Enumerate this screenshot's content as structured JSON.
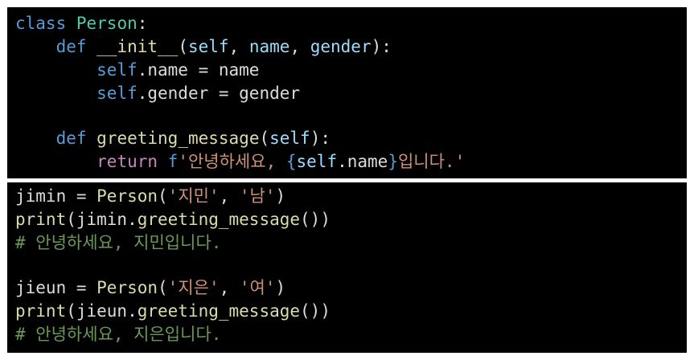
{
  "colors": {
    "background": "#000000",
    "page": "#ffffff",
    "keyword": "#569cd6",
    "class_name": "#4ec9b0",
    "function": "#dcdcaa",
    "parameter": "#9cdcfe",
    "string": "#ce9178",
    "control": "#c586c0",
    "comment": "#6a9955",
    "text": "#dcdcdc"
  },
  "top": {
    "l1_kw": "class",
    "l1_cls": "Person",
    "l1_end": ":",
    "l2_indent": "    ",
    "l2_kw": "def",
    "l2_fn": "__init__",
    "l2_open": "(",
    "l2_p1": "self",
    "l2_c1": ", ",
    "l2_p2": "name",
    "l2_c2": ", ",
    "l2_p3": "gender",
    "l2_close": "):",
    "l3_indent": "        ",
    "l3_self": "self",
    "l3_rest": ".name = name",
    "l4_indent": "        ",
    "l4_self": "self",
    "l4_rest": ".gender = gender",
    "l6_indent": "    ",
    "l6_kw": "def",
    "l6_fn": "greeting_message",
    "l6_open": "(",
    "l6_p1": "self",
    "l6_close": "):",
    "l7_indent": "        ",
    "l7_ret": "return",
    "l7_f": "f",
    "l7_str1": "'안녕하세요, ",
    "l7_brace_open": "{",
    "l7_self": "self",
    "l7_attr": ".name",
    "l7_brace_close": "}",
    "l7_str2": "입니다.'"
  },
  "bottom": {
    "b1_a": "jimin = ",
    "b1_fn": "Person",
    "b1_open": "(",
    "b1_s1": "'지민'",
    "b1_comma": ", ",
    "b1_s2": "'남'",
    "b1_close": ")",
    "b2_fn": "print",
    "b2_rest1": "(jimin.",
    "b2_fn2": "greeting_message",
    "b2_rest2": "())",
    "b3_cmt": "# 안녕하세요, 지민입니다.",
    "b5_a": "jieun = ",
    "b5_fn": "Person",
    "b5_open": "(",
    "b5_s1": "'지은'",
    "b5_comma": ", ",
    "b5_s2": "'여'",
    "b5_close": ")",
    "b6_fn": "print",
    "b6_rest1": "(jieun.",
    "b6_fn2": "greeting_message",
    "b6_rest2": "())",
    "b7_cmt": "# 안녕하세요, 지은입니다."
  }
}
